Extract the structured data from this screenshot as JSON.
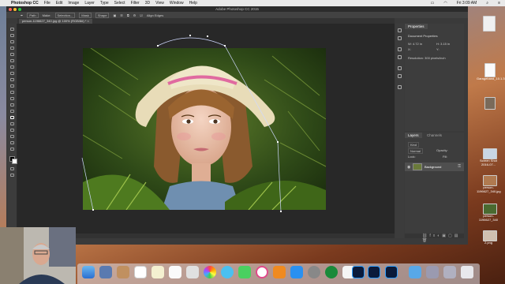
{
  "menubar": {
    "app_name": "Photoshop CC",
    "items": [
      "File",
      "Edit",
      "Image",
      "Layer",
      "Type",
      "Select",
      "Filter",
      "3D",
      "View",
      "Window",
      "Help"
    ],
    "clock": "Fri 3:09 AM",
    "status_icons": [
      "battery-icon",
      "wifi-icon",
      "search-icon",
      "menu-icon"
    ]
  },
  "window": {
    "title": "Adobe Photoshop CC 2015"
  },
  "options_bar": {
    "path_label": "Path",
    "make_label": "Make:",
    "selection_button": "Selection...",
    "mask_button": "Mask",
    "shape_button": "Shape",
    "align_edges": "Align Edges"
  },
  "document": {
    "tab_label": "person-1196627_340.jpg @ 100% (RGB/8#) *"
  },
  "properties": {
    "tab_properties": "Properties",
    "heading": "Document Properties",
    "w_label": "W:",
    "w_value": "4.72 in",
    "h_label": "H:",
    "h_value": "3.15 in",
    "x_label": "X:",
    "y_label": "Y:",
    "resolution": "Resolution: 300 pixels/inch"
  },
  "layers": {
    "tab_layers": "Layers",
    "tab_channels": "Channels",
    "kind_label": "Kind",
    "blend_mode": "Normal",
    "opacity_label": "Opacity:",
    "fill_label": "Fill:",
    "lock_label": "Lock:",
    "layer_name": "Background"
  },
  "desktop_icons": [
    {
      "label": "Garageband_10.1.3.png",
      "icon": "document-icon"
    },
    {
      "label": "Screen Shot 2016-07...",
      "icon": "screenshot-icon"
    },
    {
      "label": "person-1196627_340.jpg",
      "icon": "image-icon"
    },
    {
      "label": "girl-1128... .png",
      "icon": "image-icon"
    },
    {
      "label": "person-1196627_340",
      "icon": "image-icon"
    },
    {
      "label": "2.png",
      "icon": "image-icon"
    }
  ],
  "dock_apps": [
    "finder-icon",
    "launchpad-icon",
    "preview-icon",
    "calendar-icon",
    "notes-icon",
    "reminders-icon",
    "photos-icon",
    "messages-icon",
    "facetime-icon",
    "itunes-icon",
    "ibooks-icon",
    "appstore-icon",
    "system-preferences-icon",
    "quicktime-icon",
    "vlc-icon",
    "photoshop-icon",
    "photoshop-icon",
    "photoshop-icon",
    "folder-icon",
    "downloads-icon",
    "trash-icon"
  ],
  "colors": {
    "ps_background": "#282828",
    "panel": "#3d3d3d",
    "accent": "#2b7ad6"
  }
}
